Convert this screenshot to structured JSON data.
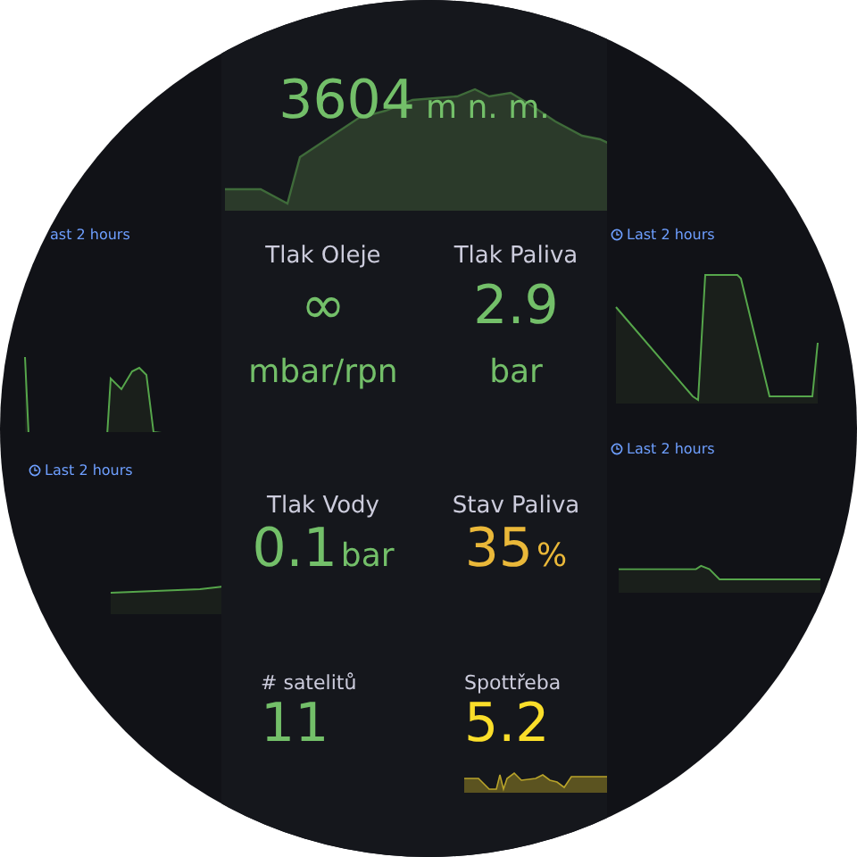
{
  "altitude": {
    "value": "3604",
    "unit": "m n. m."
  },
  "left_charts": [
    {
      "time_range": "ast 2 hours",
      "clock_icon": false
    },
    {
      "time_range": "Last 2 hours",
      "clock_icon": true
    }
  ],
  "stats": [
    {
      "title": "Tlak Oleje",
      "value": "∞",
      "unit": "mbar/rpn",
      "color": "#73bf69",
      "kind": "stacked"
    },
    {
      "title": "Tlak Paliva",
      "value": "2.9",
      "unit": "bar",
      "color": "#73bf69",
      "kind": "stacked"
    },
    {
      "title": "Tlak Vody",
      "value": "0.1",
      "unit": "bar",
      "color": "#73bf69",
      "kind": "inline"
    },
    {
      "title": "Stav Paliva",
      "value": "35",
      "unit": "%",
      "color": "#eab839",
      "kind": "inline"
    },
    {
      "title": "# satelitů",
      "value": "11",
      "color": "#73bf69",
      "kind": "plain"
    },
    {
      "title": "Spottřeba",
      "value": "5.2",
      "color": "#fade2a",
      "kind": "trend"
    }
  ],
  "right_charts": [
    {
      "time_range": "Last 2 hours",
      "clock_icon": true
    },
    {
      "time_range": "Last 2 hours",
      "clock_icon": true
    }
  ]
}
